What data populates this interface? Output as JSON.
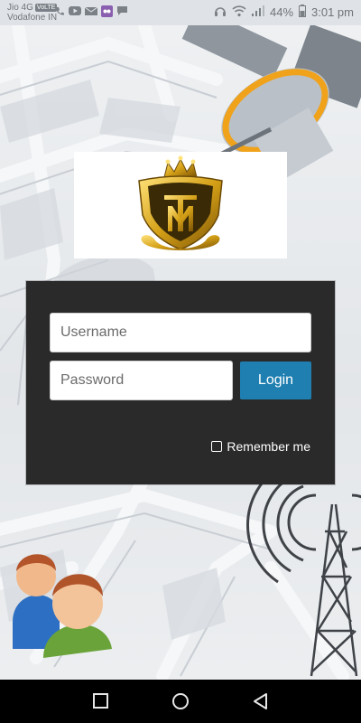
{
  "status_bar": {
    "carrier_line1": "Jio 4G",
    "volte_badge": "VoLTE",
    "carrier_line2": "Vodafone IN",
    "battery_percent": "44%",
    "time": "3:01 pm",
    "notification_icons": [
      "wifi-call-icon",
      "youtube-icon",
      "mail-icon",
      "app-icon",
      "chat-icon"
    ],
    "system_icons": [
      "headphones-icon",
      "wifi-icon",
      "signal-icon",
      "battery-icon"
    ]
  },
  "login": {
    "username_placeholder": "Username",
    "password_placeholder": "Password",
    "login_label": "Login",
    "remember_label": "Remember me",
    "remember_checked": false
  },
  "colors": {
    "panel_bg": "#2b2a2a",
    "login_button": "#1e7fb0",
    "logo_gold": "#d4a017",
    "nav_bar": "#000000"
  },
  "nav_bar": {
    "buttons": [
      "recent-apps-icon",
      "home-icon",
      "back-icon"
    ]
  }
}
